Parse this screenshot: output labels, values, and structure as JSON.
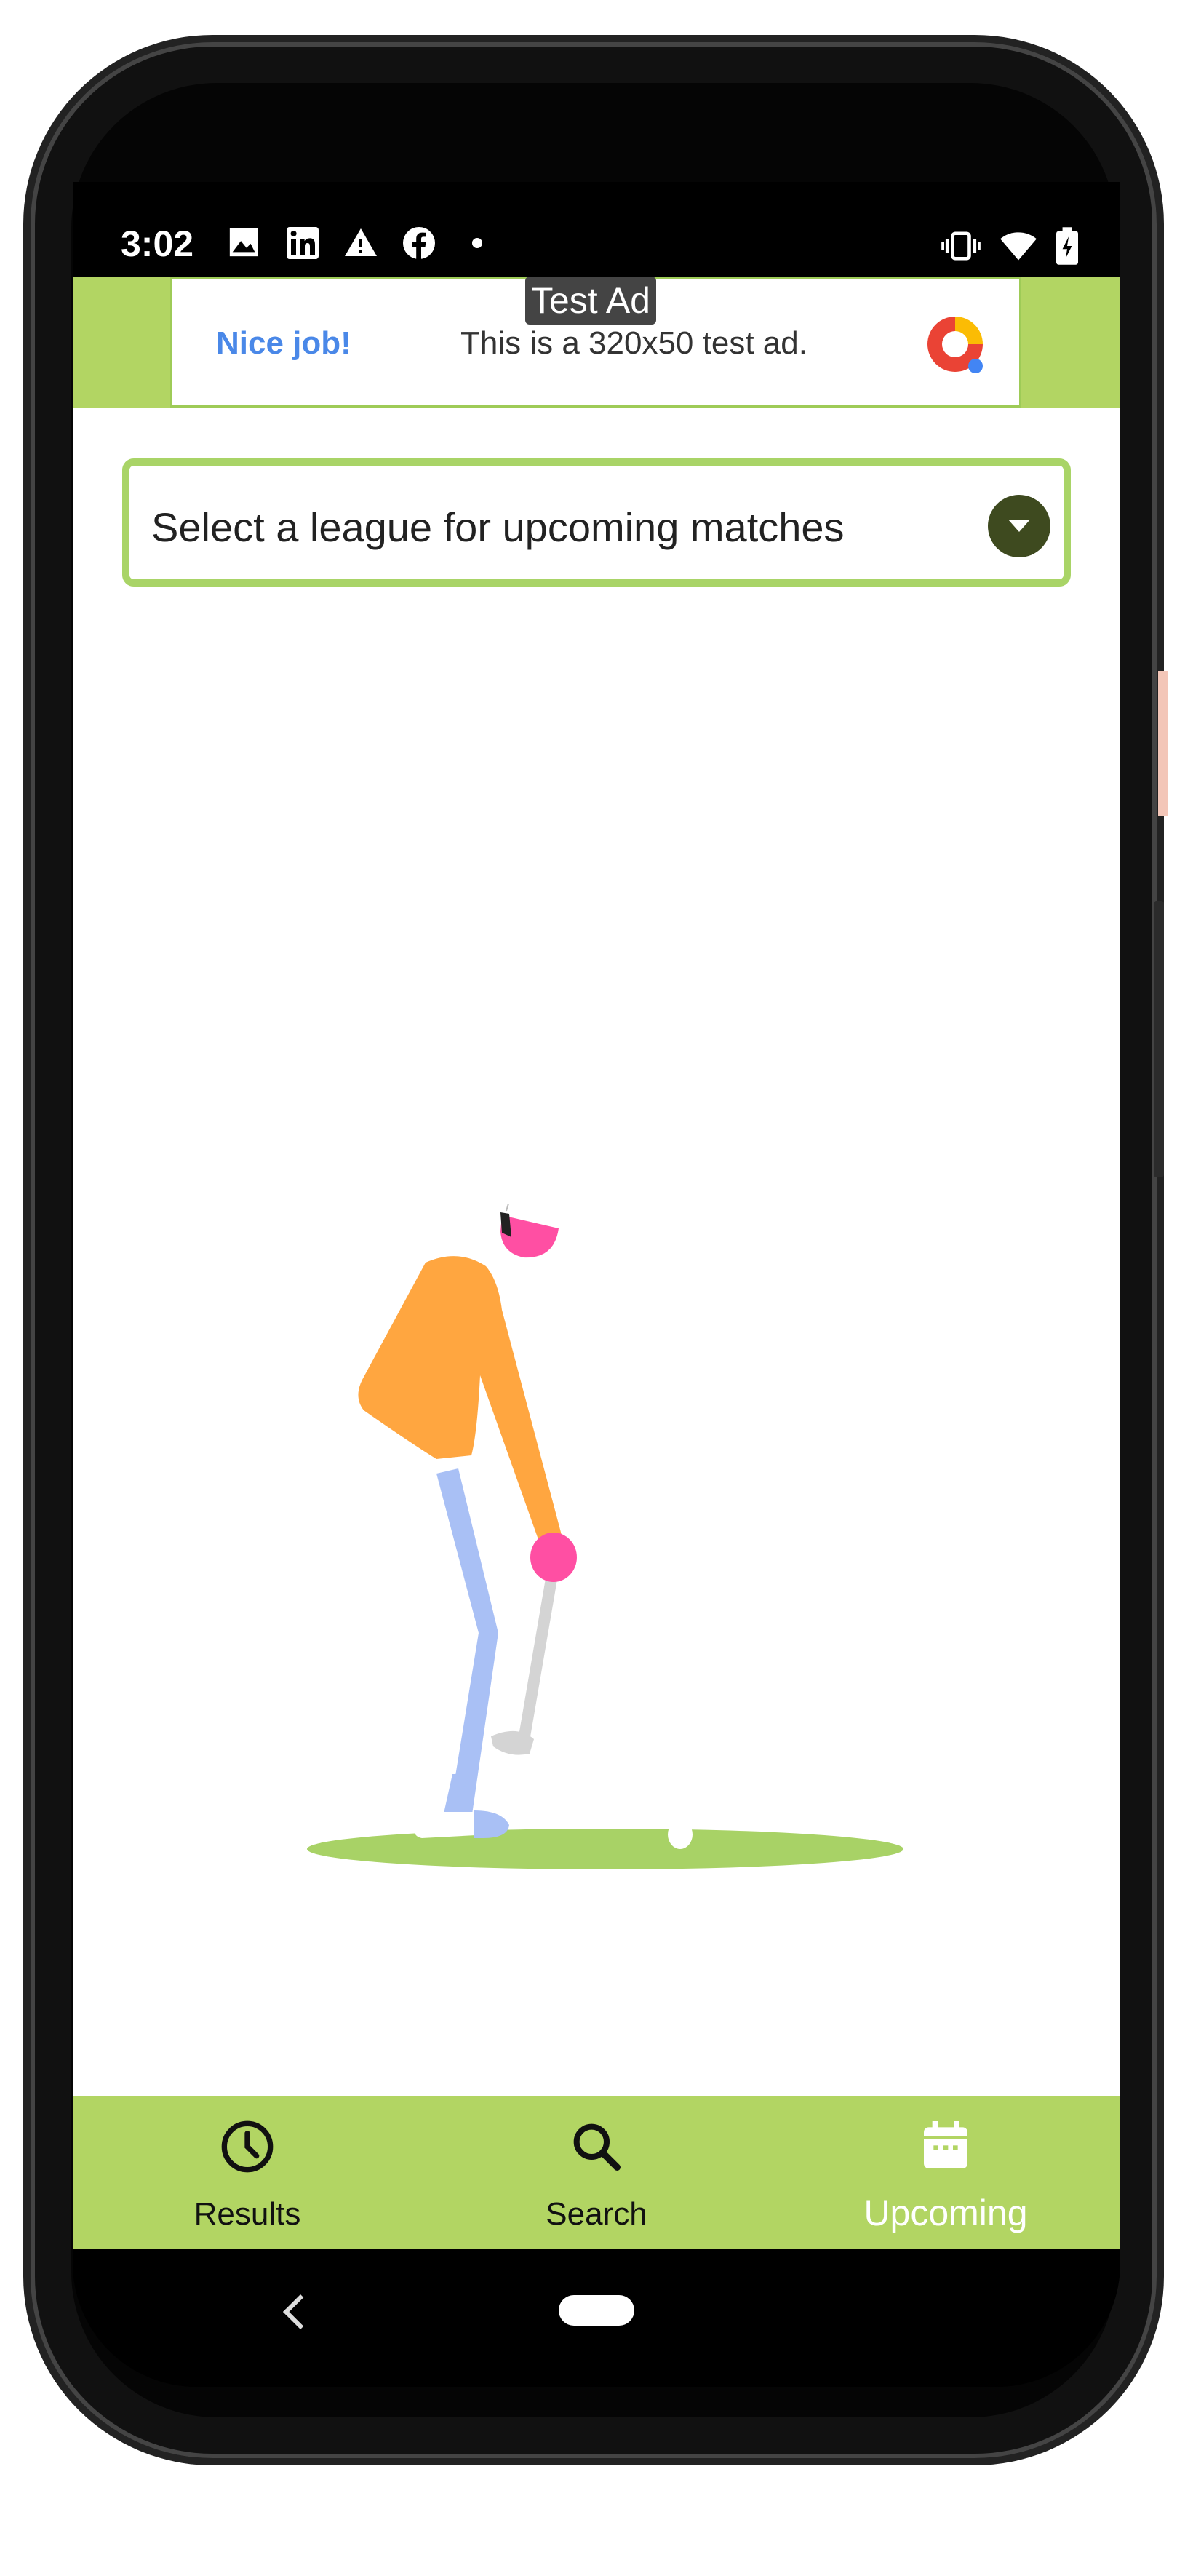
{
  "statusbar": {
    "time": "3:02",
    "icons": [
      "image-icon",
      "linkedin-icon",
      "warning-icon",
      "facebook-icon",
      "dot-icon"
    ],
    "right_icons": [
      "vibrate-icon",
      "wifi-icon",
      "battery-charging-icon"
    ]
  },
  "ad": {
    "tag": "Test Ad",
    "nice": "Nice job!",
    "message": "This is a 320x50 test ad.",
    "logo": "admob-logo"
  },
  "league": {
    "placeholder": "Select a league for upcoming matches"
  },
  "nav": {
    "results": "Results",
    "search": "Search",
    "upcoming": "Upcoming",
    "active": "upcoming"
  },
  "colors": {
    "accent": "#b2d563",
    "select_border": "#a9d467",
    "dropdown_circle": "#3e4a1f",
    "ad_text_blue": "#4a88e8"
  }
}
